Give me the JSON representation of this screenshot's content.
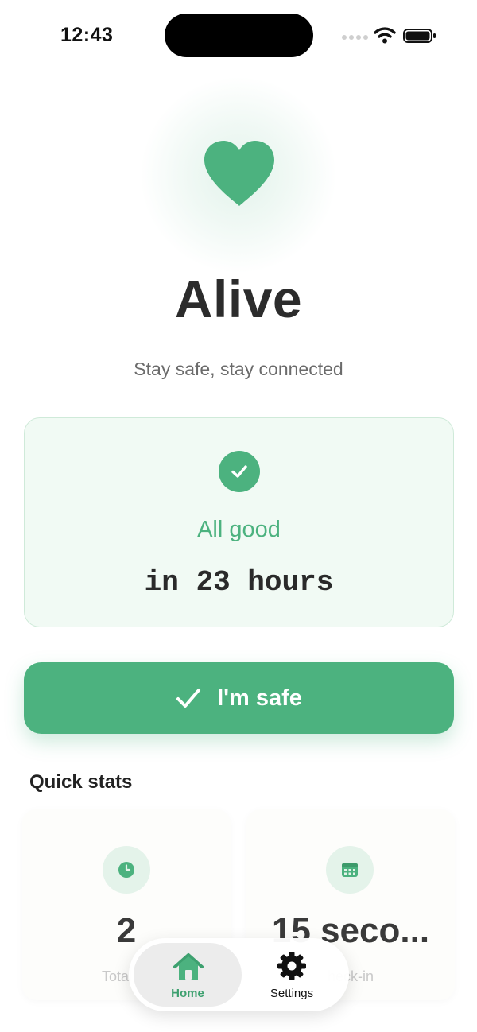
{
  "status_bar": {
    "time": "12:43"
  },
  "colors": {
    "accent": "#4cb27f",
    "card_bg": "#f1faf4",
    "text_dark": "#2c2c2c"
  },
  "header": {
    "icon": "heart-icon",
    "title": "Alive",
    "subtitle": "Stay safe, stay connected"
  },
  "status_card": {
    "icon": "check-circle-icon",
    "label": "All good",
    "countdown": "in 23 hours"
  },
  "primary_button": {
    "icon": "check-icon",
    "label": "I'm safe"
  },
  "quick_stats": {
    "title": "Quick stats",
    "items": [
      {
        "icon": "clock-icon",
        "value": "2",
        "caption": "Total ch"
      },
      {
        "icon": "calendar-icon",
        "value": "15 seco...",
        "caption": "heck-in"
      }
    ]
  },
  "tab_bar": {
    "tabs": [
      {
        "icon": "home-icon",
        "label": "Home",
        "selected": true
      },
      {
        "icon": "gear-icon",
        "label": "Settings",
        "selected": false
      }
    ]
  }
}
